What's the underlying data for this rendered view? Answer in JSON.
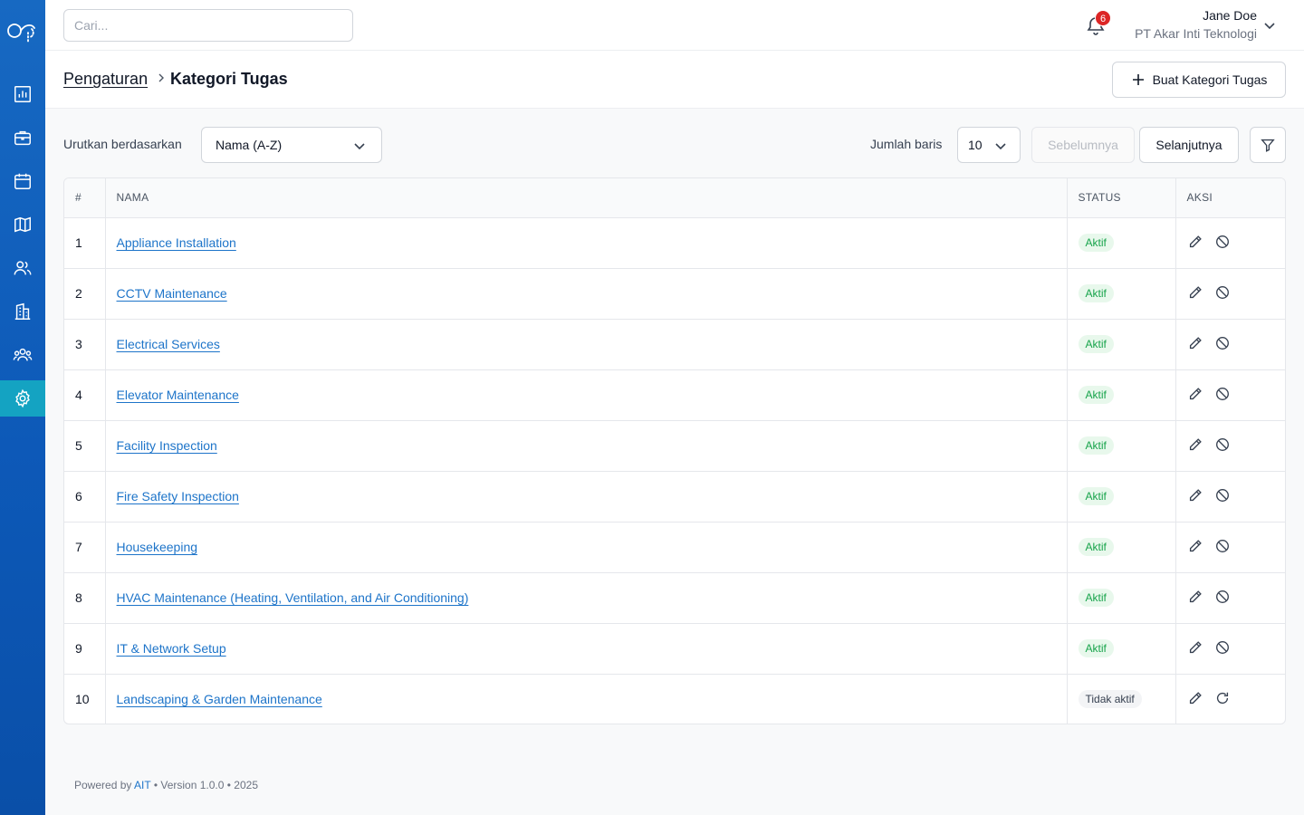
{
  "search": {
    "placeholder": "Cari..."
  },
  "notifications": {
    "count": "6"
  },
  "user": {
    "name": "Jane Doe",
    "organization": "PT Akar Inti Teknologi"
  },
  "breadcrumb": {
    "parent": "Pengaturan",
    "current": "Kategori Tugas"
  },
  "create_button": {
    "label": "Buat Kategori Tugas"
  },
  "sort": {
    "label": "Urutkan berdasarkan",
    "value": "Nama (A-Z)"
  },
  "rows": {
    "label": "Jumlah baris",
    "value": "10"
  },
  "pagination": {
    "prev": "Sebelumnya",
    "next": "Selanjutnya"
  },
  "table": {
    "headers": {
      "num": "#",
      "name": "NAMA",
      "status": "STATUS",
      "actions": "AKSI"
    },
    "rows": [
      {
        "num": "1",
        "name": "Appliance Installation",
        "status": "Aktif",
        "active": true
      },
      {
        "num": "2",
        "name": "CCTV Maintenance",
        "status": "Aktif",
        "active": true
      },
      {
        "num": "3",
        "name": "Electrical Services",
        "status": "Aktif",
        "active": true
      },
      {
        "num": "4",
        "name": "Elevator Maintenance",
        "status": "Aktif",
        "active": true
      },
      {
        "num": "5",
        "name": "Facility Inspection",
        "status": "Aktif",
        "active": true
      },
      {
        "num": "6",
        "name": "Fire Safety Inspection",
        "status": "Aktif",
        "active": true
      },
      {
        "num": "7",
        "name": "Housekeeping",
        "status": "Aktif",
        "active": true
      },
      {
        "num": "8",
        "name": "HVAC Maintenance (Heating, Ventilation, and Air Conditioning)",
        "status": "Aktif",
        "active": true
      },
      {
        "num": "9",
        "name": "IT & Network Setup",
        "status": "Aktif",
        "active": true
      },
      {
        "num": "10",
        "name": "Landscaping & Garden Maintenance",
        "status": "Tidak aktif",
        "active": false
      }
    ]
  },
  "sidebar": {
    "items": [
      {
        "icon": "chart-icon"
      },
      {
        "icon": "briefcase-icon"
      },
      {
        "icon": "calendar-icon"
      },
      {
        "icon": "map-icon"
      },
      {
        "icon": "users-icon"
      },
      {
        "icon": "building-icon"
      },
      {
        "icon": "team-icon"
      },
      {
        "icon": "gear-icon",
        "active": true
      }
    ]
  },
  "footer": {
    "prefix": "Powered by",
    "brand": "AIT",
    "suffix": "• Version 1.0.0 • 2025"
  },
  "colors": {
    "sidebar": "#0d59b8",
    "sidebar_active": "#14a3c2",
    "link": "#1d74c9",
    "badge_active": "#16a34a"
  }
}
